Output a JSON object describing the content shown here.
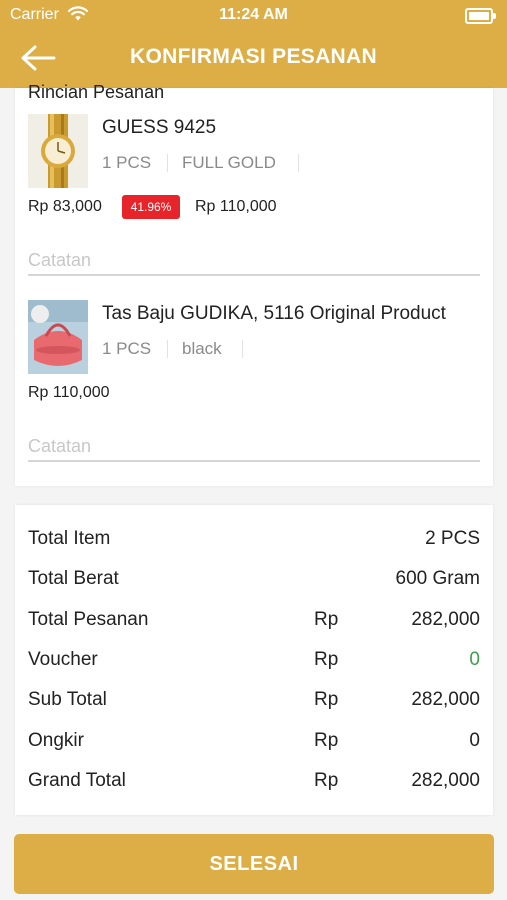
{
  "status_bar": {
    "carrier": "Carrier",
    "time": "11:24 AM"
  },
  "header": {
    "title": "KONFIRMASI PESANAN",
    "back_icon": "arrow-left-icon"
  },
  "order": {
    "section_title": "Rincian Pesanan",
    "items": [
      {
        "name": "GUESS 9425",
        "qty": "1 PCS",
        "variant": "FULL GOLD",
        "price": "Rp 83,000",
        "discount": "41.96%",
        "original_price": "Rp 110,000",
        "note_placeholder": "Catatan",
        "thumb": "gold-watch-image"
      },
      {
        "name": "Tas Baju GUDIKA, 5116 Original Product",
        "qty": "1 PCS",
        "variant": "black",
        "price": "Rp 110,000",
        "note_placeholder": "Catatan",
        "thumb": "red-duffel-bag-image"
      }
    ]
  },
  "summary": {
    "rows": [
      {
        "label": "Total Item",
        "currency": "",
        "value": "2 PCS"
      },
      {
        "label": "Total Berat",
        "currency": "",
        "value": "600 Gram"
      },
      {
        "label": "Total Pesanan",
        "currency": "Rp",
        "value": "282,000"
      },
      {
        "label": "Voucher",
        "currency": "Rp",
        "value": "0"
      },
      {
        "label": "Sub Total",
        "currency": "Rp",
        "value": "282,000"
      },
      {
        "label": "Ongkir",
        "currency": "Rp",
        "value": "0"
      },
      {
        "label": "Grand Total",
        "currency": "Rp",
        "value": "282,000"
      }
    ]
  },
  "footer": {
    "button_label": "SELESAI"
  },
  "colors": {
    "brand": "#ddae45",
    "discount": "#e8242b",
    "voucher_value": "#3aa14a"
  }
}
